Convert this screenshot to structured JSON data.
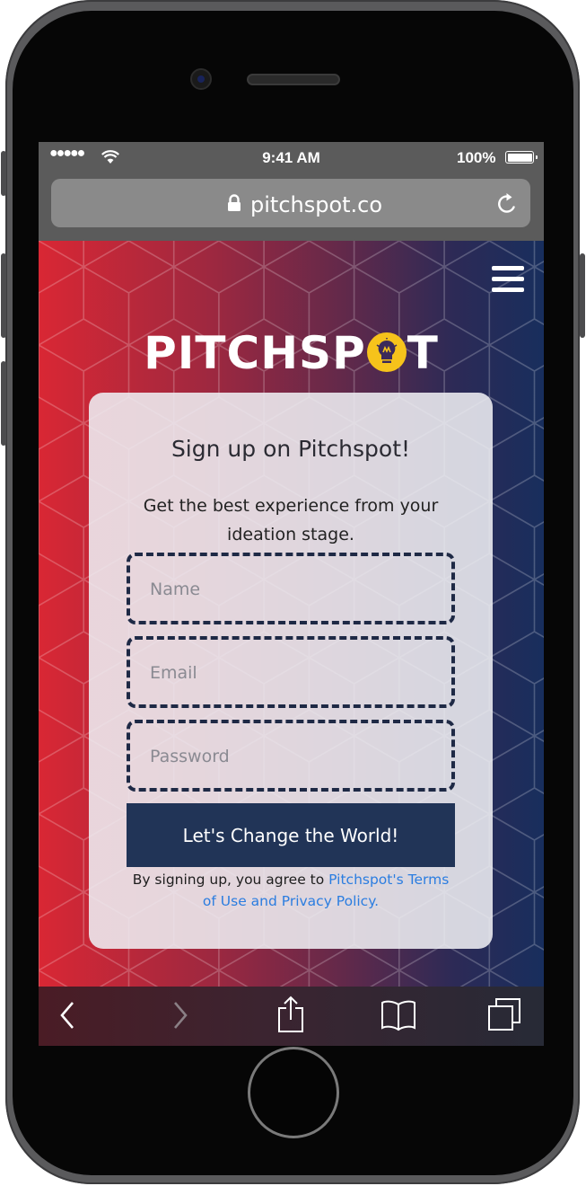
{
  "status_bar": {
    "signal": "●●●●●",
    "time": "9:41 AM",
    "battery": "100%"
  },
  "browser": {
    "url": "pitchspot.co"
  },
  "site": {
    "logo_left": "PITCHSP",
    "logo_right": "T",
    "logo_accent": "#f6c31b"
  },
  "signup": {
    "title": "Sign up on Pitchspot!",
    "subtitle": "Get the best experience from your ideation stage.",
    "name_placeholder": "Name",
    "email_placeholder": "Email",
    "password_placeholder": "Password",
    "submit_label": "Let's Change the World!",
    "legal_prefix": "By signing up, you agree to ",
    "legal_link": "Pitchspot's Terms of Use and Privacy Policy."
  },
  "colors": {
    "gradient_start": "#d92734",
    "gradient_end": "#182e5d",
    "button": "#213457",
    "link": "#2b7de0"
  },
  "icons": {
    "menu": "hamburger-menu-icon",
    "toolbar": [
      "back-icon",
      "forward-icon",
      "share-icon",
      "bookmarks-icon",
      "tabs-icon"
    ]
  }
}
